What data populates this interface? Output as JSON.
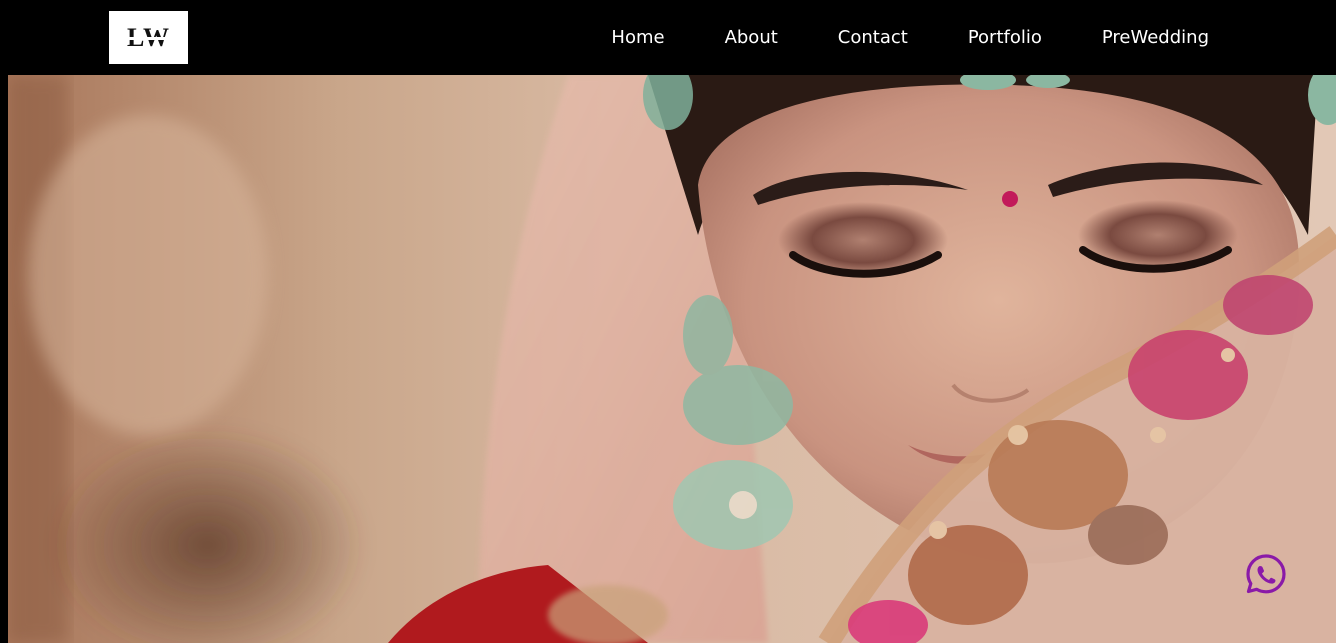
{
  "header": {
    "logo_text": "LW",
    "nav": [
      {
        "label": "Home"
      },
      {
        "label": "About"
      },
      {
        "label": "Contact"
      },
      {
        "label": "Portfolio"
      },
      {
        "label": "PreWedding"
      }
    ]
  },
  "hero": {
    "image_icon": "bride-photo"
  },
  "floating": {
    "icon": "whatsapp-icon",
    "color": "#8a1aa8"
  },
  "colors": {
    "nav_bg": "#000000",
    "nav_text": "#ffffff"
  }
}
